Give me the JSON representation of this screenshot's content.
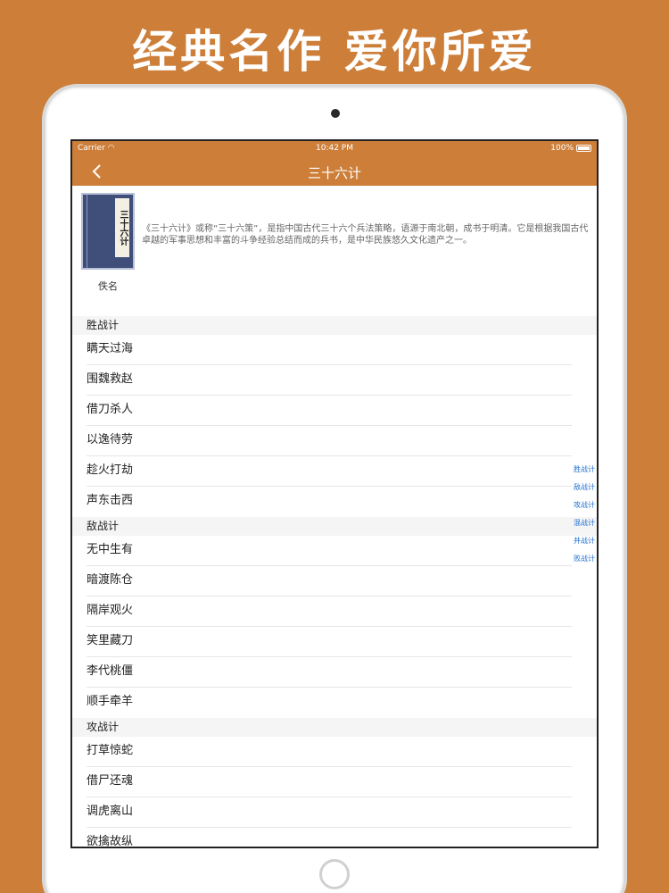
{
  "promo": {
    "title": "经典名作 爱你所爱"
  },
  "status": {
    "carrier": "Carrier",
    "time": "10:42 PM",
    "battery": "100%"
  },
  "nav": {
    "title": "三十六计"
  },
  "book": {
    "cover_title": "三十六计",
    "author": "佚名",
    "intro": "《三十六计》或称“三十六策”，是指中国古代三十六个兵法策略，语源于南北朝，成书于明清。它是根据我国古代卓越的军事思想和丰富的斗争经验总结而成的兵书，是中华民族悠久文化遗产之一。"
  },
  "sections": [
    {
      "title": "胜战计",
      "items": [
        "瞒天过海",
        "围魏救赵",
        "借刀杀人",
        "以逸待劳",
        "趁火打劫",
        "声东击西"
      ]
    },
    {
      "title": "敌战计",
      "items": [
        "无中生有",
        "暗渡陈仓",
        "隔岸观火",
        "笑里藏刀",
        "李代桃僵",
        "顺手牵羊"
      ]
    },
    {
      "title": "攻战计",
      "items": [
        "打草惊蛇",
        "借尸还魂",
        "调虎离山",
        "欲擒故纵"
      ]
    }
  ],
  "index": [
    "胜战计",
    "敌战计",
    "攻战计",
    "混战计",
    "并战计",
    "败战计"
  ],
  "colors": {
    "accent": "#cd7f3a",
    "index_link": "#1f6fd0"
  }
}
